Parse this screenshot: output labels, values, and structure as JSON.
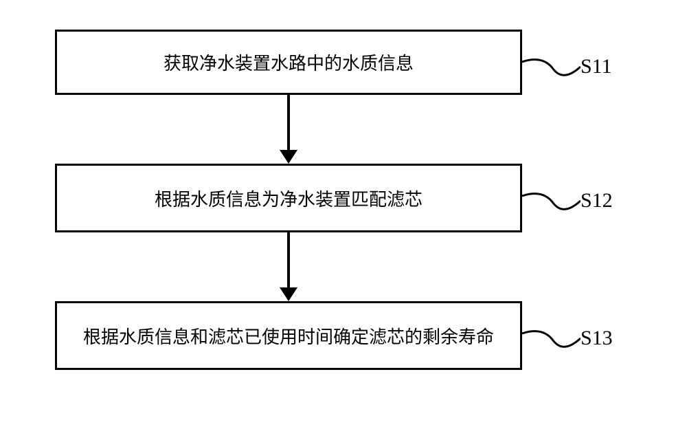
{
  "chart_data": {
    "type": "flowchart",
    "steps": [
      {
        "id": "S11",
        "text": "获取净水装置水路中的水质信息"
      },
      {
        "id": "S12",
        "text": "根据水质信息为净水装置匹配滤芯"
      },
      {
        "id": "S13",
        "text": "根据水质信息和滤芯已使用时间确定滤芯的剩余寿命"
      }
    ],
    "flow": [
      "S11",
      "S12",
      "S13"
    ]
  },
  "boxes": {
    "step1": {
      "text": "获取净水装置水路中的水质信息",
      "label": "S11"
    },
    "step2": {
      "text": "根据水质信息为净水装置匹配滤芯",
      "label": "S12"
    },
    "step3": {
      "text": "根据水质信息和滤芯已使用时间确定滤芯的剩余寿命",
      "label": "S13"
    }
  }
}
